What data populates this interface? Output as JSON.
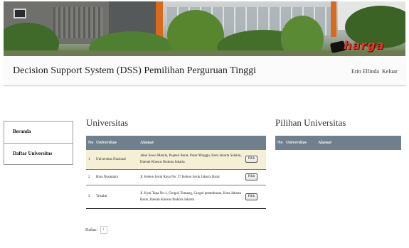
{
  "banner": {
    "brand_text": "harga",
    "logo_icon": "car-silhouette-icon"
  },
  "header": {
    "title": "Decision Support System (DSS) Pemilihan Perguruan Tinggi",
    "user": "Erin Ellinda",
    "logout": "Keluar"
  },
  "sidebar": {
    "items": [
      {
        "label": "Beranda"
      },
      {
        "label": "Daftar Universitas"
      }
    ]
  },
  "universitas": {
    "title": "Universitas",
    "columns": [
      "No",
      "Universitas",
      "Alamat",
      ""
    ],
    "rows": [
      {
        "no": "1",
        "name": "Universitas Nasional",
        "address": "Jalan Sawo Manila, Pejaten Barat, Pasar Minggu, Kota Jakarta Selatan, Daerah Khusus Ibukota Jakarta",
        "action": "Pilih"
      },
      {
        "no": "2",
        "name": "Bina Nusantara",
        "address": "Jl. Kebon Jeruk Raya No. 27 Kebon Jeruk Jakarta Barat",
        "action": "Pilih"
      },
      {
        "no": "3",
        "name": "Trisakti",
        "address": "Jl. Kyai Tapa No.1, Grogol, Tomang, Grogol petamburan, Kota Jakarta Barat, Daerah Khusus Ibukota Jakarta",
        "action": "Pilih"
      }
    ],
    "pager_label": "Daftar :",
    "pager_page": "1"
  },
  "pilihan": {
    "title": "Pilihan Universitas",
    "columns": [
      "No",
      "Universitas",
      "Alamat"
    ]
  },
  "colors": {
    "table_header": "#6f7f8b",
    "highlight_row": "#f5f0d5",
    "brand": "#e23a2c"
  }
}
